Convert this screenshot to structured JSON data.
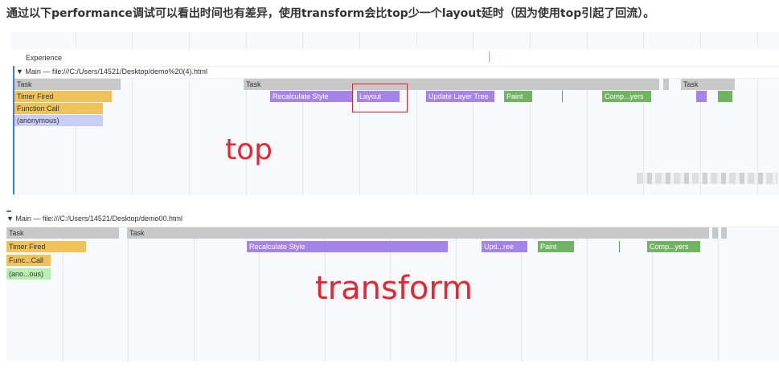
{
  "caption": "通过以下performance调试可以看出时间也有差异，使用transform会比top少一个layout延时（因为使用top引起了回流）。",
  "top_panel": {
    "experience_label": "Experience",
    "main_header": "▼ Main — file:///C:/Users/14521/Desktop/demo%20(4).html",
    "tasks": [
      "Task",
      "Task",
      "Task"
    ],
    "timer_fired": "Timer Fired",
    "function_call": "Function Call",
    "anonymous": "(anonymous)",
    "recalculate_style": "Recalculate Style",
    "layout": "Layout",
    "update_layer_tree": "Update Layer Tree",
    "paint": "Paint",
    "composite": "Comp...yers",
    "annotation": "top"
  },
  "bottom_panel": {
    "main_header": "▼ Main — file:///C:/Users/14521/Desktop/demo00.html",
    "tasks": [
      "Task",
      "Task"
    ],
    "timer_fired": "Timer Fired",
    "function_call": "Func...Call",
    "anonymous": "(ano...ous)",
    "recalculate_style": "Recalculate Style",
    "update_layer_tree": "Upd...ree",
    "paint": "Paint",
    "composite": "Comp...yers",
    "annotation": "transform"
  },
  "colors": {
    "task": "#c8c8c8",
    "scripting": "#f0c35a",
    "rendering": "#a484e9",
    "painting": "#71b363",
    "highlight": "#e0242b",
    "annotation": "#e8262f"
  }
}
